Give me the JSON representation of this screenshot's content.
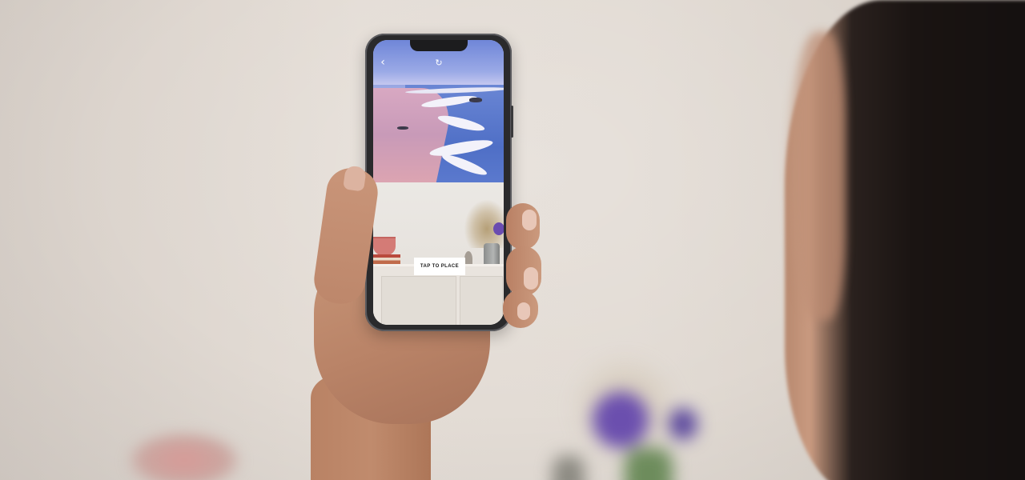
{
  "app": {
    "nav": {
      "back_icon": "chevron-left-icon",
      "reset_icon": "rotate-icon"
    },
    "ar_view": {
      "place_button_label": "TAP TO PLACE"
    }
  },
  "colors": {
    "button_bg": "#ffffff",
    "button_text": "#1a1a1a",
    "icon": "#ffffff"
  }
}
